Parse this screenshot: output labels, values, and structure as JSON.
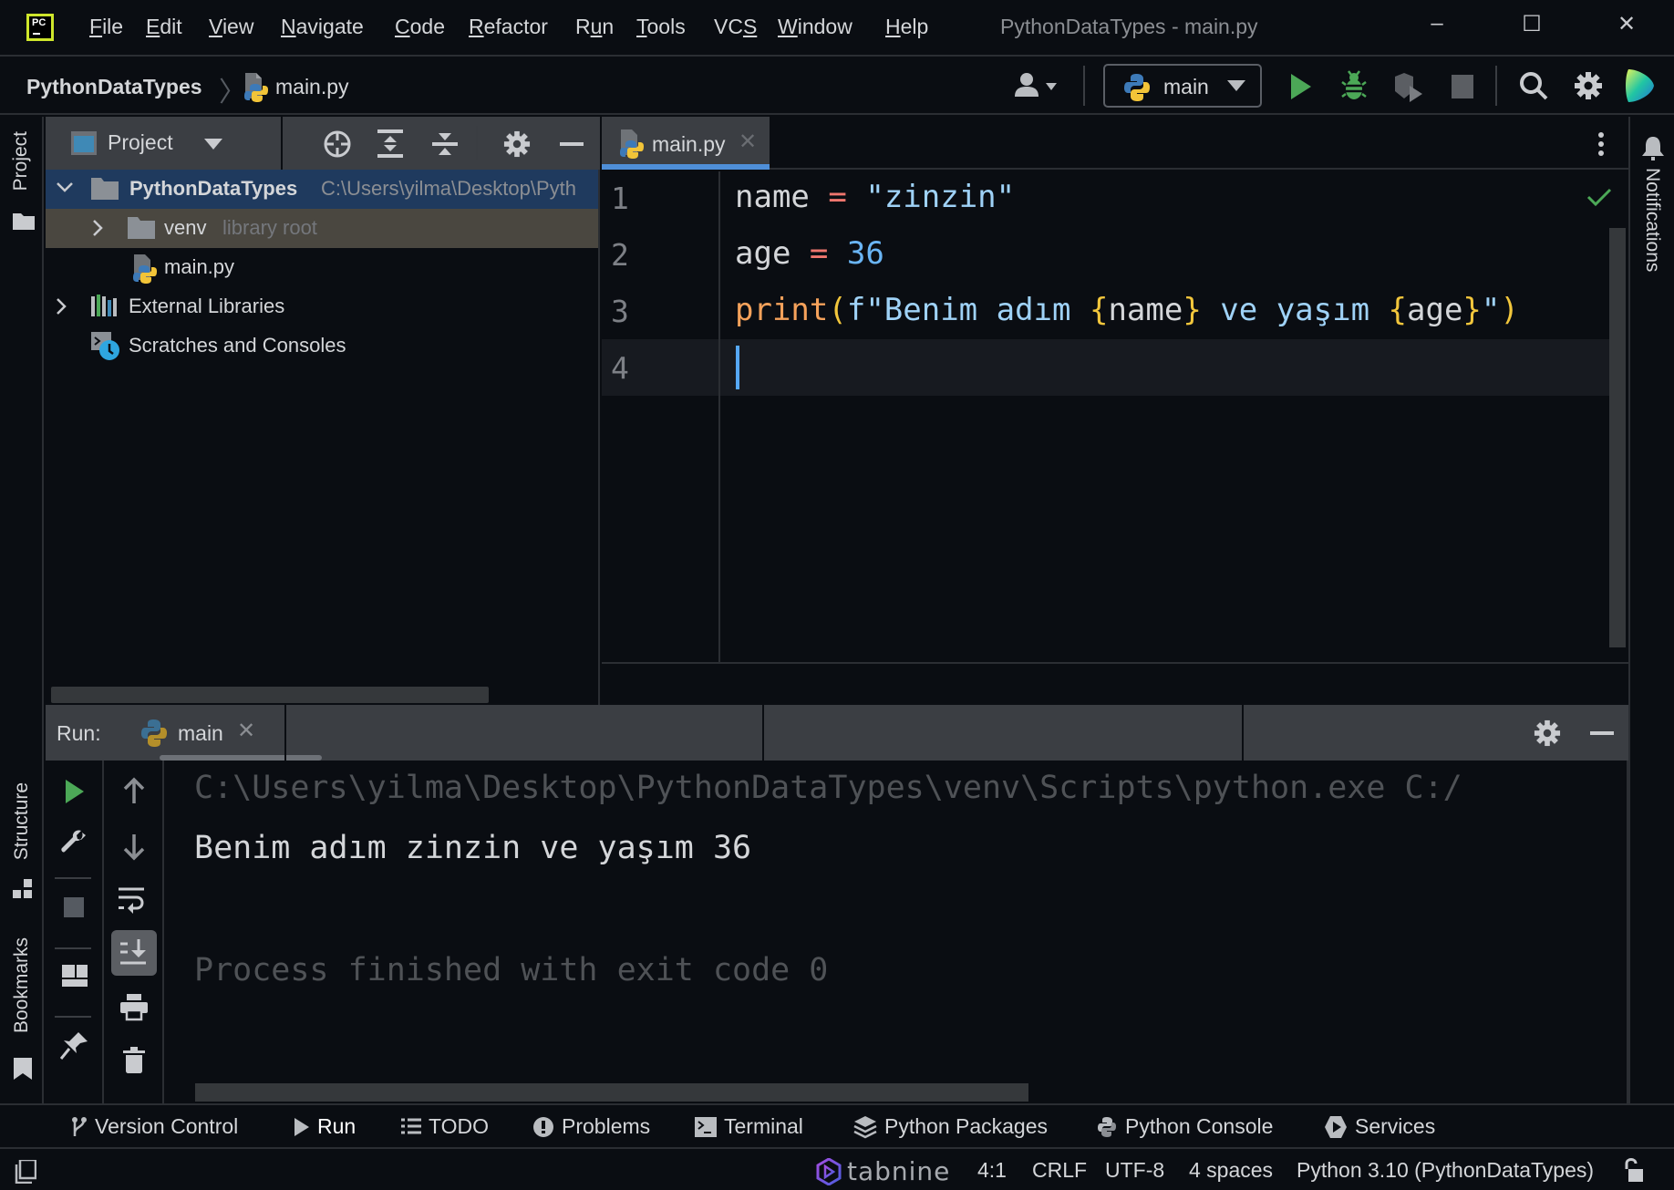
{
  "window": {
    "app_logo_text": "PC",
    "title": "PythonDataTypes - main.py",
    "menu": [
      {
        "label": "File",
        "mnemonic": "F",
        "rest": "ile"
      },
      {
        "label": "Edit",
        "mnemonic": "E",
        "rest": "dit"
      },
      {
        "label": "View",
        "mnemonic": "V",
        "rest": "iew"
      },
      {
        "label": "Navigate",
        "mnemonic": "N",
        "rest": "avigate"
      },
      {
        "label": "Code",
        "mnemonic": "C",
        "rest": "ode"
      },
      {
        "label": "Refactor",
        "mnemonic": "R",
        "rest": "efactor"
      },
      {
        "label": "Run",
        "pre": "R",
        "mnemonic": "u",
        "rest": "n"
      },
      {
        "label": "Tools",
        "mnemonic": "T",
        "rest": "ools"
      },
      {
        "label": "VCS",
        "pre": "VC",
        "mnemonic": "S",
        "rest": ""
      },
      {
        "label": "Window",
        "mnemonic": "W",
        "rest": "indow"
      },
      {
        "label": "Help",
        "mnemonic": "H",
        "rest": "elp"
      }
    ],
    "controls": {
      "minimize": "–",
      "maximize": "☐",
      "close": "✕"
    }
  },
  "navbar": {
    "project": "PythonDataTypes",
    "separator": "〉",
    "file": "main.py",
    "run_config": "main"
  },
  "left_strip": {
    "project_tab": "Project",
    "structure_tab": "Structure",
    "bookmarks_tab": "Bookmarks"
  },
  "right_strip": {
    "notifications_tab": "Notifications"
  },
  "project_panel": {
    "title": "Project",
    "tree": [
      {
        "name": "PythonDataTypes",
        "detail": "C:\\Users\\yilma\\Desktop\\Pyth",
        "expanded": true,
        "selected": true
      },
      {
        "name": "venv",
        "detail": "library root",
        "expanded": false
      },
      {
        "name": "main.py"
      },
      {
        "name": "External Libraries",
        "expanded": false
      },
      {
        "name": "Scratches and Consoles"
      }
    ]
  },
  "editor": {
    "tab_label": "main.py",
    "tab_close": "✕",
    "line_numbers": [
      "1",
      "2",
      "3",
      "4"
    ],
    "lines": [
      [
        {
          "t": "name",
          "c": "id"
        },
        {
          "t": " ",
          "c": "id"
        },
        {
          "t": "=",
          "c": "op"
        },
        {
          "t": " ",
          "c": "id"
        },
        {
          "t": "\"zinzin\"",
          "c": "str"
        }
      ],
      [
        {
          "t": "age",
          "c": "id"
        },
        {
          "t": " ",
          "c": "id"
        },
        {
          "t": "=",
          "c": "op"
        },
        {
          "t": " ",
          "c": "id"
        },
        {
          "t": "36",
          "c": "num"
        }
      ],
      [
        {
          "t": "print",
          "c": "fn"
        },
        {
          "t": "(",
          "c": "br"
        },
        {
          "t": "f\"Benim adım ",
          "c": "str"
        },
        {
          "t": "{",
          "c": "br"
        },
        {
          "t": "name",
          "c": "id"
        },
        {
          "t": "}",
          "c": "br"
        },
        {
          "t": " ve yaşım ",
          "c": "str"
        },
        {
          "t": "{",
          "c": "br"
        },
        {
          "t": "age",
          "c": "id"
        },
        {
          "t": "}",
          "c": "br"
        },
        {
          "t": "\"",
          "c": "str"
        },
        {
          "t": ")",
          "c": "br"
        }
      ],
      []
    ],
    "inspection_status": "ok"
  },
  "run_panel": {
    "label": "Run:",
    "tab_label": "main",
    "tab_close": "✕",
    "console": {
      "command": "C:\\Users\\yilma\\Desktop\\PythonDataTypes\\venv\\Scripts\\python.exe C:/",
      "output": "Benim adım zinzin ve yaşım 36",
      "exit": "Process finished with exit code 0"
    }
  },
  "tool_windows": [
    {
      "label": "Version Control",
      "icon": "branch-icon"
    },
    {
      "label": "Run",
      "icon": "run-icon"
    },
    {
      "label": "TODO",
      "icon": "list-icon"
    },
    {
      "label": "Problems",
      "icon": "warning-icon"
    },
    {
      "label": "Terminal",
      "icon": "terminal-icon"
    },
    {
      "label": "Python Packages",
      "icon": "layers-icon"
    },
    {
      "label": "Python Console",
      "icon": "python-icon"
    },
    {
      "label": "Services",
      "icon": "services-icon"
    }
  ],
  "status_bar": {
    "plugin": "tabnine",
    "position": "4:1",
    "line_separator": "CRLF",
    "encoding": "UTF-8",
    "indent": "4 spaces",
    "interpreter": "Python 3.10 (PythonDataTypes)"
  },
  "colors": {
    "accent": "#4f8fd8",
    "run_green": "#4ca857",
    "logo_yellow": "#cfe62b"
  }
}
